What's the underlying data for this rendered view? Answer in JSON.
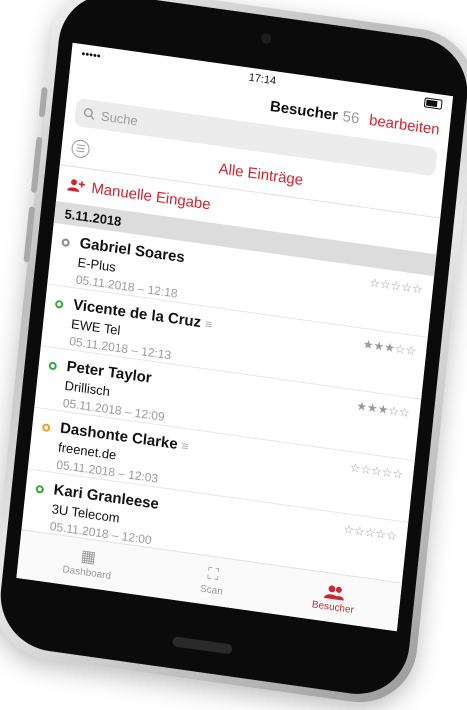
{
  "status_bar": {
    "signal": "•••••",
    "time": "17:14"
  },
  "header": {
    "title": "Besucher",
    "count": "56",
    "edit_label": "bearbeiten"
  },
  "search": {
    "placeholder": "Suche"
  },
  "filter": {
    "label": "Alle Einträge"
  },
  "manual_entry": {
    "label": "Manuelle Eingabe"
  },
  "section": {
    "date": "5.11.2018"
  },
  "visitors": [
    {
      "name": "Gabriel Soares",
      "company": "E-Plus",
      "timestamp": "05.11.2018 – 12:18",
      "stars": "☆☆☆☆☆",
      "status_color": "#8a8a8a",
      "has_note": false
    },
    {
      "name": "Vicente de la Cruz",
      "company": "EWE Tel",
      "timestamp": "05.11.2018 – 12:13",
      "stars": "★★★☆☆",
      "status_color": "#2ea836",
      "has_note": true
    },
    {
      "name": "Peter Taylor",
      "company": "Drillisch",
      "timestamp": "05.11.2018 – 12:09",
      "stars": "★★★☆☆",
      "status_color": "#2ea836",
      "has_note": false
    },
    {
      "name": "Dashonte Clarke",
      "company": "freenet.de",
      "timestamp": "05.11.2018 – 12:03",
      "stars": "☆☆☆☆☆",
      "status_color": "#f0a020",
      "has_note": true
    },
    {
      "name": "Kari Granleese",
      "company": "3U Telecom",
      "timestamp": "05.11.2018 – 12:00",
      "stars": "☆☆☆☆☆",
      "status_color": "#2ea836",
      "has_note": false
    }
  ],
  "tabbar": {
    "dashboard_label": "Dashboard",
    "scan_label": "Scan",
    "visitors_label": "Besucher"
  },
  "icons": {
    "search": "search-icon",
    "filter": "filter-icon",
    "add_user": "add-user-icon",
    "note": "note-icon",
    "dashboard": "grid-icon",
    "scan": "scan-frame-icon",
    "visitors": "people-icon"
  },
  "colors": {
    "accent": "#d4232e",
    "section_bg": "#dcdcdc",
    "muted": "#9a9a9a"
  }
}
